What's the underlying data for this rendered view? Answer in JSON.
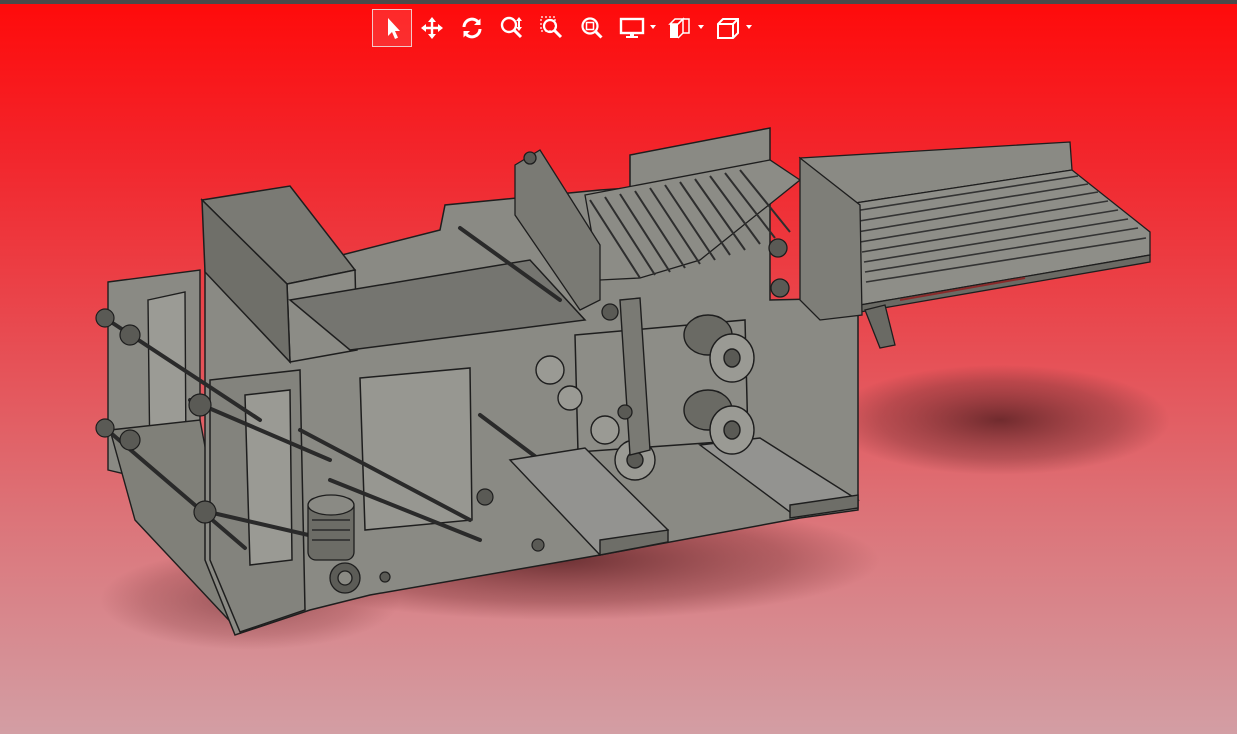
{
  "window": {
    "accent_color": "#ff0a0a",
    "background_bottom_color": "#d39ea4"
  },
  "toolbar": {
    "buttons": [
      {
        "name": "select-tool",
        "icon": "cursor-arrow-icon",
        "active": true
      },
      {
        "name": "pan-tool",
        "icon": "move-arrows-icon",
        "active": false
      },
      {
        "name": "rotate-tool",
        "icon": "rotate-icon",
        "active": false
      },
      {
        "name": "zoom-tool",
        "icon": "zoom-in-out-icon",
        "active": false
      },
      {
        "name": "zoom-window-tool",
        "icon": "zoom-window-icon",
        "active": false
      },
      {
        "name": "zoom-fit-tool",
        "icon": "zoom-fit-icon",
        "active": false
      },
      {
        "name": "display-mode-menu",
        "icon": "monitor-icon",
        "active": false,
        "has_dropdown": true
      },
      {
        "name": "section-view-menu",
        "icon": "section-view-icon",
        "active": false,
        "has_dropdown": true
      },
      {
        "name": "standard-views-menu",
        "icon": "cube-view-icon",
        "active": false,
        "has_dropdown": true
      }
    ]
  },
  "viewport": {
    "model": "machine-assembly",
    "model_color": "#8a8a84",
    "edge_color": "#1e1e1e"
  }
}
